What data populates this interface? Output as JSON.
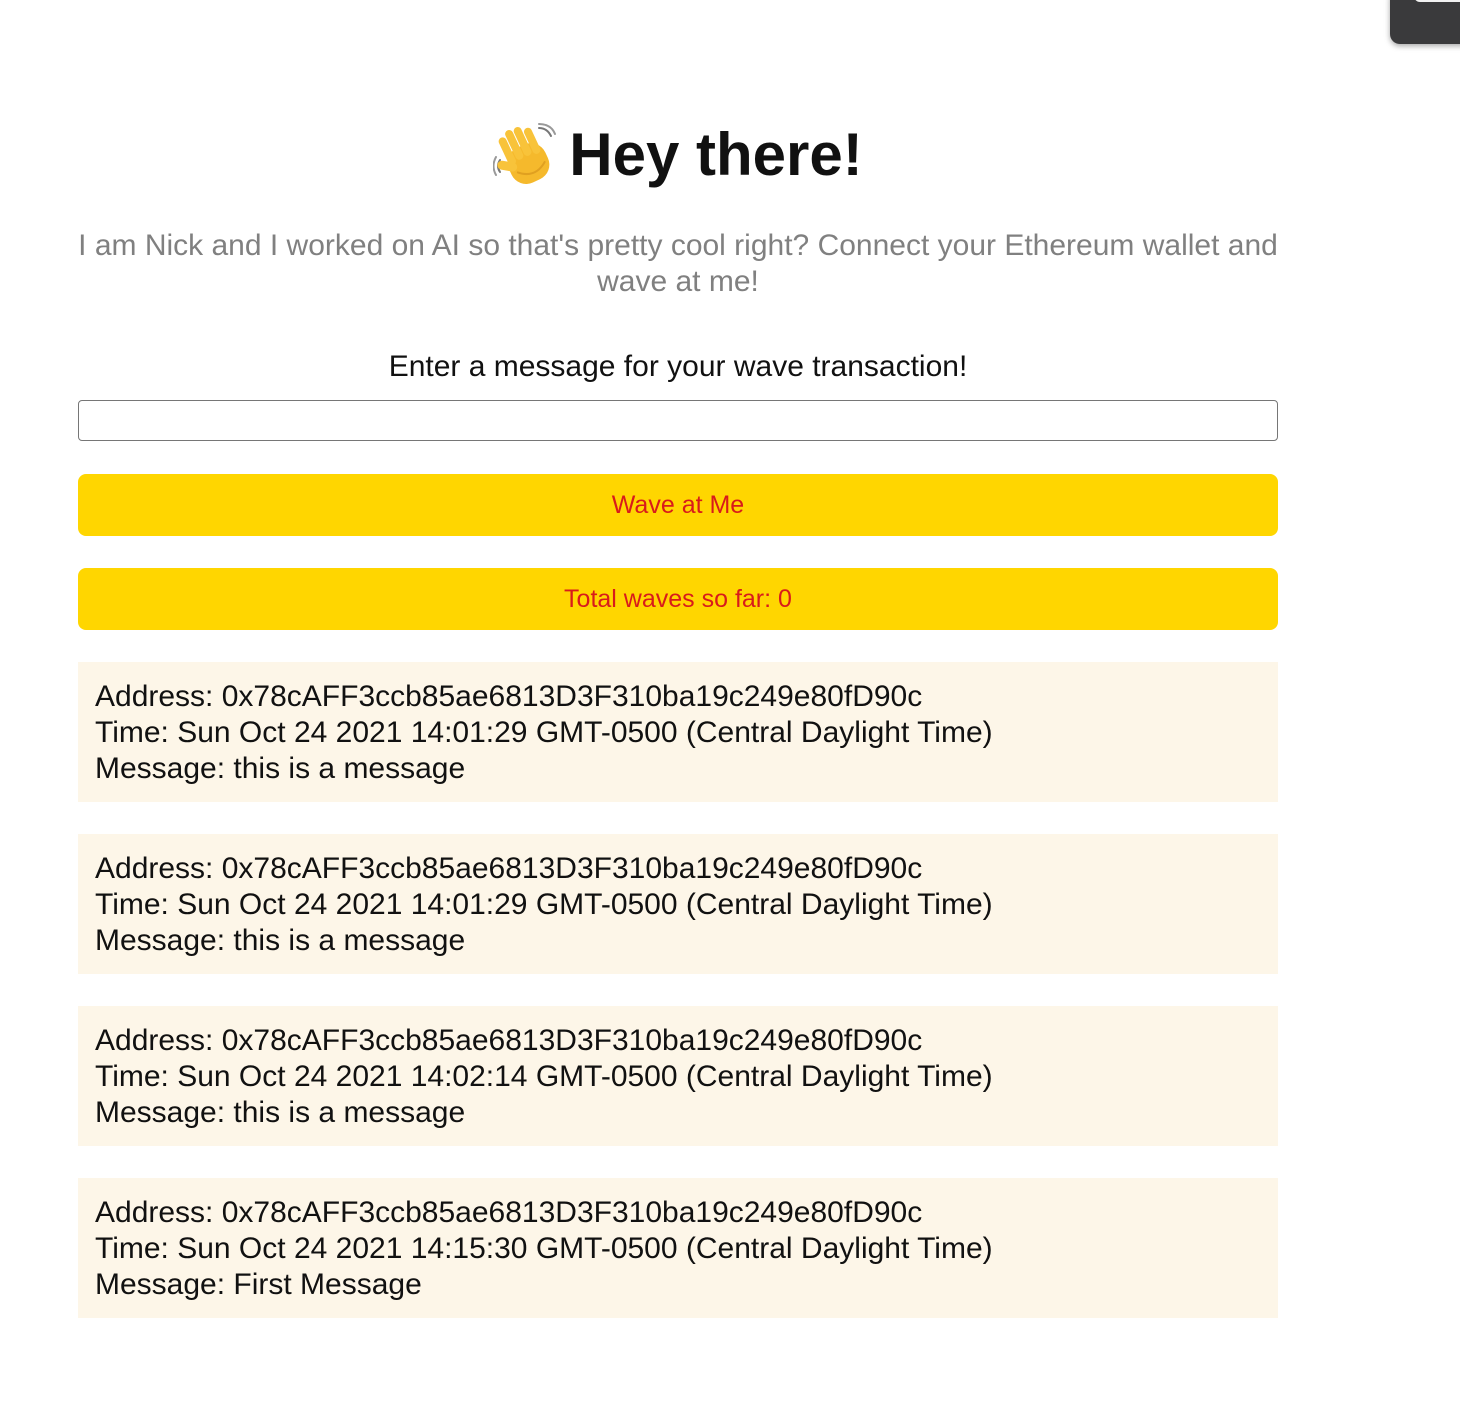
{
  "header": {
    "emoji_icon": "waving-hand-icon",
    "title": "Hey there!"
  },
  "bio": "I am Nick and I worked on AI so that's pretty cool right? Connect your Ethereum wallet and wave at me!",
  "prompt_label": "Enter a message for your wave transaction!",
  "message_input": {
    "value": "",
    "placeholder": ""
  },
  "wave_button_label": "Wave at Me",
  "total_waves_label": "Total waves so far: 0",
  "colors": {
    "button_bg": "#ffd600",
    "button_text": "#d81b1b",
    "card_bg": "#fdf6e8",
    "subtitle_text": "#808080"
  },
  "waves": [
    {
      "address": "Address: 0x78cAFF3ccb85ae6813D3F310ba19c249e80fD90c",
      "time": "Time: Sun Oct 24 2021 14:01:29 GMT-0500 (Central Daylight Time)",
      "message": "Message: this is a message"
    },
    {
      "address": "Address: 0x78cAFF3ccb85ae6813D3F310ba19c249e80fD90c",
      "time": "Time: Sun Oct 24 2021 14:01:29 GMT-0500 (Central Daylight Time)",
      "message": "Message: this is a message"
    },
    {
      "address": "Address: 0x78cAFF3ccb85ae6813D3F310ba19c249e80fD90c",
      "time": "Time: Sun Oct 24 2021 14:02:14 GMT-0500 (Central Daylight Time)",
      "message": "Message: this is a message"
    },
    {
      "address": "Address: 0x78cAFF3ccb85ae6813D3F310ba19c249e80fD90c",
      "time": "Time: Sun Oct 24 2021 14:15:30 GMT-0500 (Central Daylight Time)",
      "message": "Message: First Message"
    }
  ]
}
